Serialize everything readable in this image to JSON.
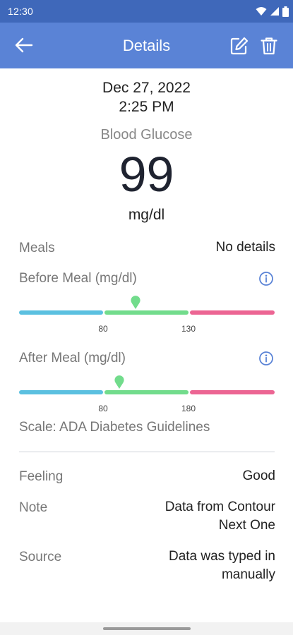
{
  "status_bar": {
    "time": "12:30",
    "icons": [
      "wifi-icon",
      "signal-icon",
      "battery-icon"
    ]
  },
  "app_bar": {
    "title": "Details",
    "back_icon": "arrow-left-icon",
    "edit_icon": "edit-icon",
    "delete_icon": "trash-icon"
  },
  "reading": {
    "date": "Dec 27, 2022",
    "time": "2:25 PM",
    "metric": "Blood Glucose",
    "value": "99",
    "unit": "mg/dl"
  },
  "meals": {
    "label": "Meals",
    "value": "No details"
  },
  "before_meal": {
    "label": "Before Meal (mg/dl)",
    "low_tick": "80",
    "high_tick": "130",
    "low_threshold": 80,
    "high_threshold": 130,
    "reading": 99
  },
  "after_meal": {
    "label": "After Meal (mg/dl)",
    "low_tick": "80",
    "high_tick": "180",
    "low_threshold": 80,
    "high_threshold": 180,
    "reading": 99
  },
  "scale_note": "Scale: ADA Diabetes Guidelines",
  "details": [
    {
      "label": "Feeling",
      "value": "Good"
    },
    {
      "label": "Note",
      "value_line1": "Data from Contour",
      "value_line2": "Next One"
    },
    {
      "label": "Source",
      "value_line1": "Data was typed in",
      "value_line2": "manually"
    }
  ],
  "colors": {
    "status_bar": "#3f68ba",
    "app_bar": "#5a83d6",
    "range_low": "#5bc0e0",
    "range_target": "#72dc8c",
    "range_high": "#ec6593",
    "info_icon": "#5a83d6"
  }
}
